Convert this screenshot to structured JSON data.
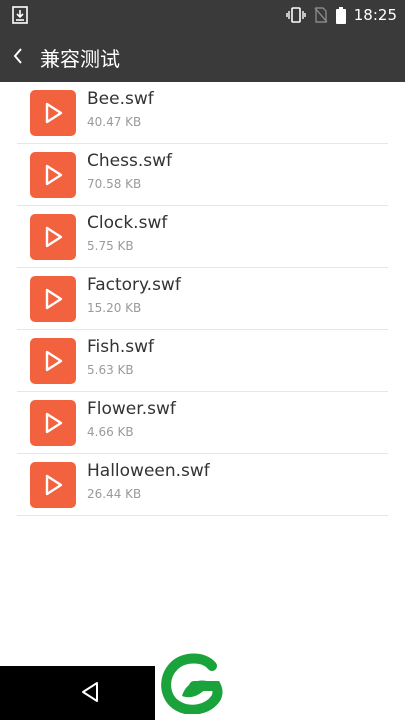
{
  "statusbar": {
    "time": "18:25",
    "icons": [
      "download-icon",
      "vibrate-icon",
      "no-sim-icon",
      "battery-icon"
    ]
  },
  "appbar": {
    "title": "兼容测试",
    "back_icon": "chevron-left-icon"
  },
  "files": [
    {
      "name": "Bee.swf",
      "size": "40.47 KB"
    },
    {
      "name": "Chess.swf",
      "size": "70.58 KB"
    },
    {
      "name": "Clock.swf",
      "size": "5.75 KB"
    },
    {
      "name": "Factory.swf",
      "size": "15.20 KB"
    },
    {
      "name": "Fish.swf",
      "size": "5.63 KB"
    },
    {
      "name": "Flower.swf",
      "size": "4.66 KB"
    },
    {
      "name": "Halloween.swf",
      "size": "26.44 KB"
    }
  ],
  "colors": {
    "appbar": "#3a3a3a",
    "file_icon": "#f2623f",
    "logo": "#1aa33a"
  },
  "navbar": {
    "back_icon": "triangle-back-icon"
  }
}
